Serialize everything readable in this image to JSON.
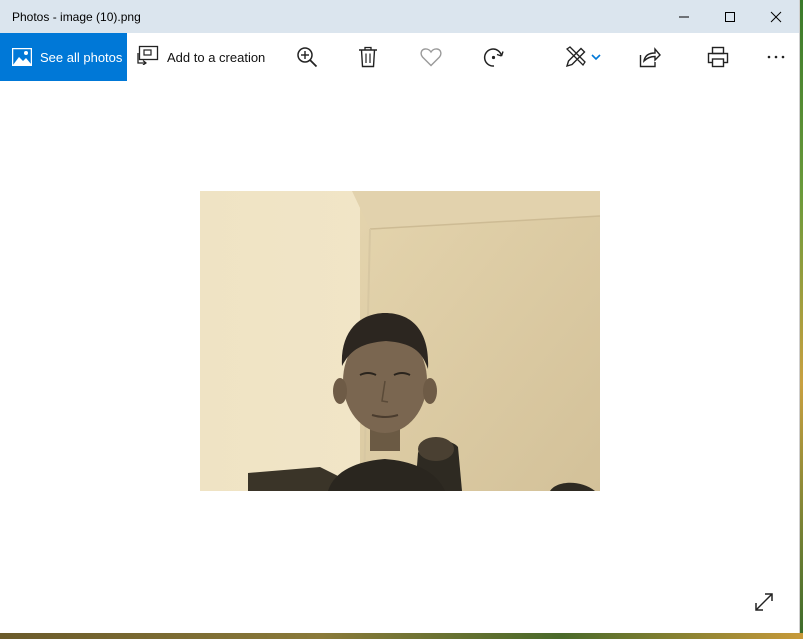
{
  "window": {
    "title": "Photos - image (10).png"
  },
  "toolbar": {
    "see_all_photos": "See all photos",
    "add_to_creation": "Add to a creation",
    "tools": [
      "zoom-in-icon",
      "delete-icon",
      "favorite-icon",
      "rotate-icon",
      "edit-draw-icon",
      "share-icon",
      "print-icon",
      "more-icon"
    ]
  },
  "colors": {
    "accent": "#0078d7",
    "titlebar": "#dbe5ee"
  }
}
